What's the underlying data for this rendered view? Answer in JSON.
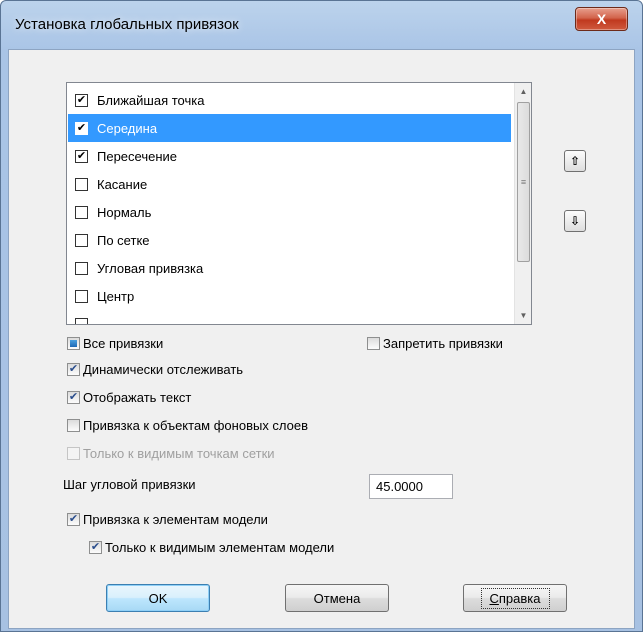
{
  "window": {
    "title": "Установка глобальных привязок",
    "close_label": "X"
  },
  "snap_list": {
    "items": [
      {
        "label": "Ближайшая точка",
        "checked": true
      },
      {
        "label": "Середина",
        "checked": true,
        "selected": true
      },
      {
        "label": "Пересечение",
        "checked": true
      },
      {
        "label": "Касание",
        "checked": false
      },
      {
        "label": "Нормаль",
        "checked": false
      },
      {
        "label": "По сетке",
        "checked": false
      },
      {
        "label": "Угловая привязка",
        "checked": false
      },
      {
        "label": "Центр",
        "checked": false
      }
    ],
    "check_glyph": "✔"
  },
  "side_buttons": {
    "up_glyph": "⇧",
    "down_glyph": "⇩"
  },
  "options": {
    "all_snaps": "Все привязки",
    "forbid_snaps": "Запретить привязки",
    "dynamic_tracking": "Динамически отслеживать",
    "show_text": "Отображать текст",
    "snap_background_layers": "Привязка к объектам фоновых слоев",
    "only_visible_grid_points": "Только к видимым точкам сетки",
    "snap_model_elements": "Привязка к элементам модели",
    "only_visible_model_elements": "Только к видимым элементам модели"
  },
  "angle_step": {
    "label": "Шаг угловой привязки",
    "value": "45.0000"
  },
  "buttons": {
    "ok": "OK",
    "cancel": "Отмена",
    "help_first": "С",
    "help_rest": "правка"
  },
  "colors": {
    "selection": "#3399ff",
    "close_button": "#c0391f",
    "title_bar": "#a9c4e6"
  }
}
